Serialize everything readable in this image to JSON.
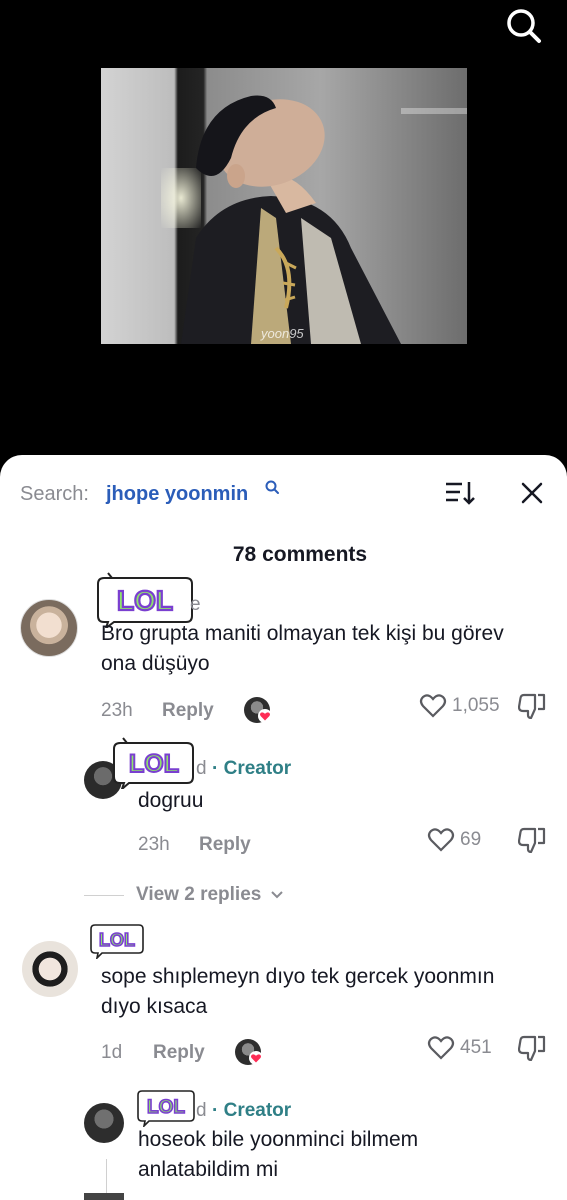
{
  "video": {
    "watermark": "yoon95"
  },
  "header": {
    "search_prefix": "Search:",
    "search_term": "jhope yoonmin",
    "comment_count": "78 comments"
  },
  "sticker_text": "LOL",
  "comments": [
    {
      "username_suffix": "e",
      "text": "Bro grupta maniti olmayan tek kişi bu görev ona düşüyo",
      "time": "23h",
      "reply_label": "Reply",
      "likes": "1,055"
    },
    {
      "username_suffix": "d",
      "creator_label": "· Creator",
      "text": "dogruu",
      "time": "23h",
      "reply_label": "Reply",
      "likes": "69"
    },
    {
      "text": "sope shıplemeyn dıyo tek gercek yoonmın dıyo kısaca",
      "time": "1d",
      "reply_label": "Reply",
      "likes": "451"
    },
    {
      "username_suffix": "d",
      "creator_label": "· Creator",
      "text": "hoseok bile yoonminci bilmem anlatabildim mi"
    }
  ],
  "view_replies": "View 2 replies",
  "colors": {
    "accent_search": "#2b5db9",
    "creator": "#2f7f86",
    "muted": "#8a8b91",
    "heart_red": "#fe2c55",
    "lol_purple": "#7a3fd0",
    "lol_green": "#8fe36b"
  }
}
